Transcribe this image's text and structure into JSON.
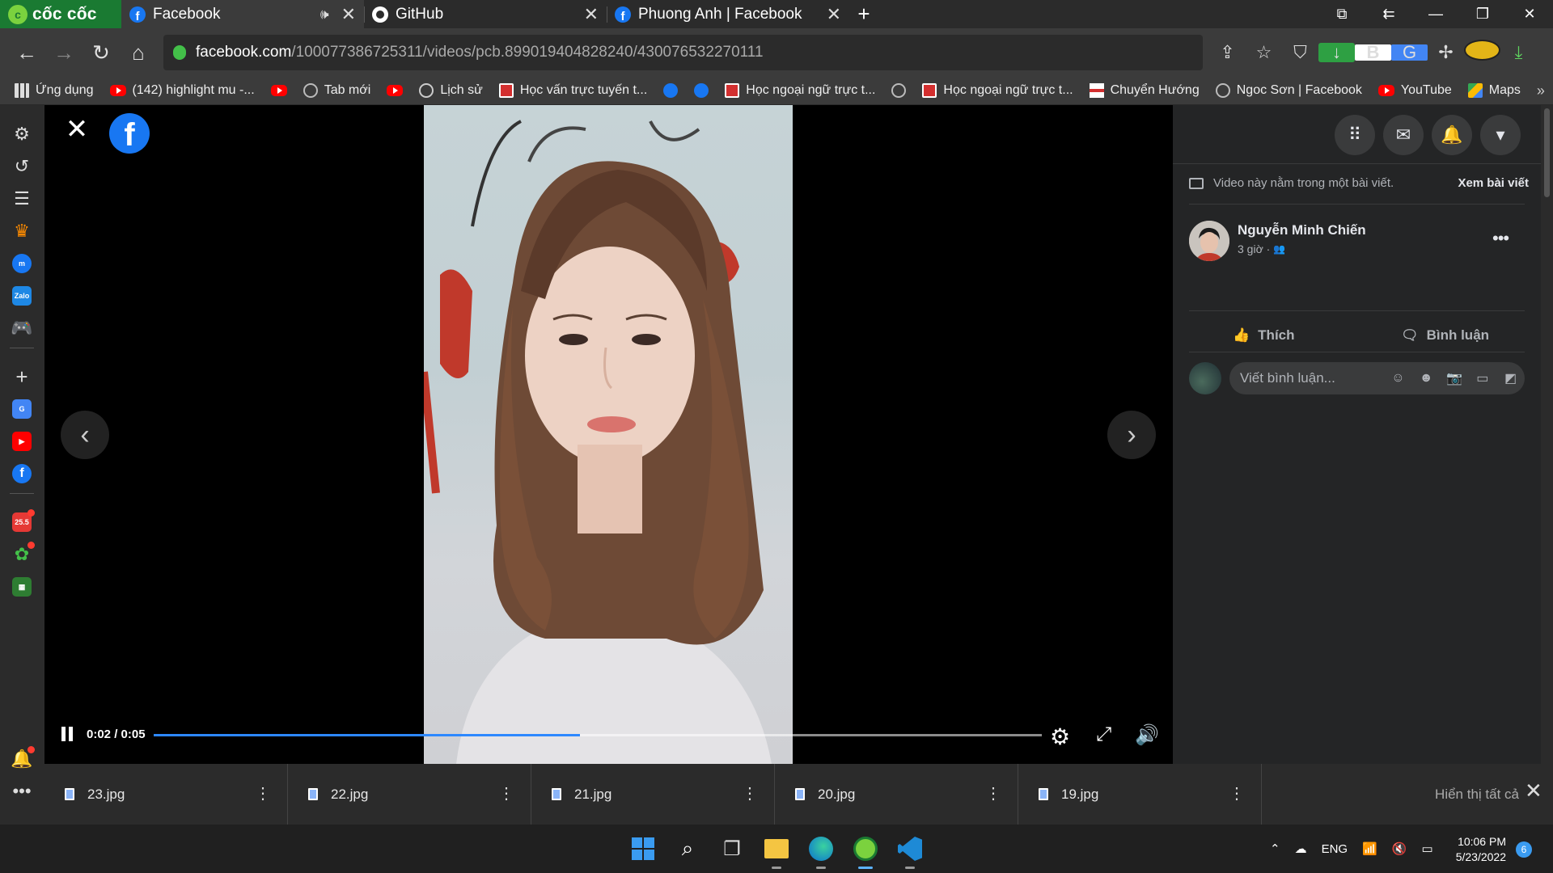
{
  "browser": {
    "brand": "cốc cốc",
    "tabs": [
      {
        "title": "Facebook",
        "active": true,
        "favicon": "facebook-icon",
        "audio": true
      },
      {
        "title": "GitHub",
        "active": false,
        "favicon": "github-icon"
      },
      {
        "title": "Phuong Anh | Facebook",
        "active": false,
        "favicon": "facebook-icon"
      }
    ],
    "url_domain": "facebook.com",
    "url_path": "/100077386725311/videos/pcb.899019404828240/430076532270111"
  },
  "bookmarks": [
    {
      "label": "Ứng dụng",
      "icon": "apps"
    },
    {
      "label": "(142) highlight mu -...",
      "icon": "yt"
    },
    {
      "label": "",
      "icon": "yt"
    },
    {
      "label": "Tab mới",
      "icon": "globe"
    },
    {
      "label": "",
      "icon": "yt"
    },
    {
      "label": "Lịch sử",
      "icon": "hist"
    },
    {
      "label": "Học vấn trực tuyến t...",
      "icon": "red"
    },
    {
      "label": "",
      "icon": "fb"
    },
    {
      "label": "",
      "icon": "fb"
    },
    {
      "label": "Học ngoại ngữ trực t...",
      "icon": "red"
    },
    {
      "label": "",
      "icon": "globe"
    },
    {
      "label": "Học ngoại ngữ trực t...",
      "icon": "red"
    },
    {
      "label": "Chuyển Hướng",
      "icon": "flag"
    },
    {
      "label": "Ngoc Sơn | Facebook",
      "icon": "globe"
    },
    {
      "label": "YouTube",
      "icon": "yt"
    },
    {
      "label": "Maps",
      "icon": "maps"
    }
  ],
  "sidebar_badges": {
    "calendar": "25.5"
  },
  "video": {
    "current_time": "0:02",
    "duration": "0:05",
    "progress": 0.48
  },
  "post": {
    "notice": "Video này nằm trong một bài viết.",
    "view_post": "Xem bài viết",
    "author": "Nguyễn Minh Chiến",
    "time": "3 giờ ·",
    "like": "Thích",
    "comment": "Bình luận",
    "comment_placeholder": "Viết bình luận..."
  },
  "downloads": {
    "items": [
      "23.jpg",
      "22.jpg",
      "21.jpg",
      "20.jpg",
      "19.jpg"
    ],
    "show_all": "Hiển thị tất cả"
  },
  "taskbar": {
    "language": "ENG",
    "time": "10:06 PM",
    "date": "5/23/2022",
    "notifications": "6"
  },
  "colors": {
    "facebook_blue": "#1877f2",
    "coccoc_green": "#1a7a32",
    "progress_blue": "#2d88ff"
  }
}
